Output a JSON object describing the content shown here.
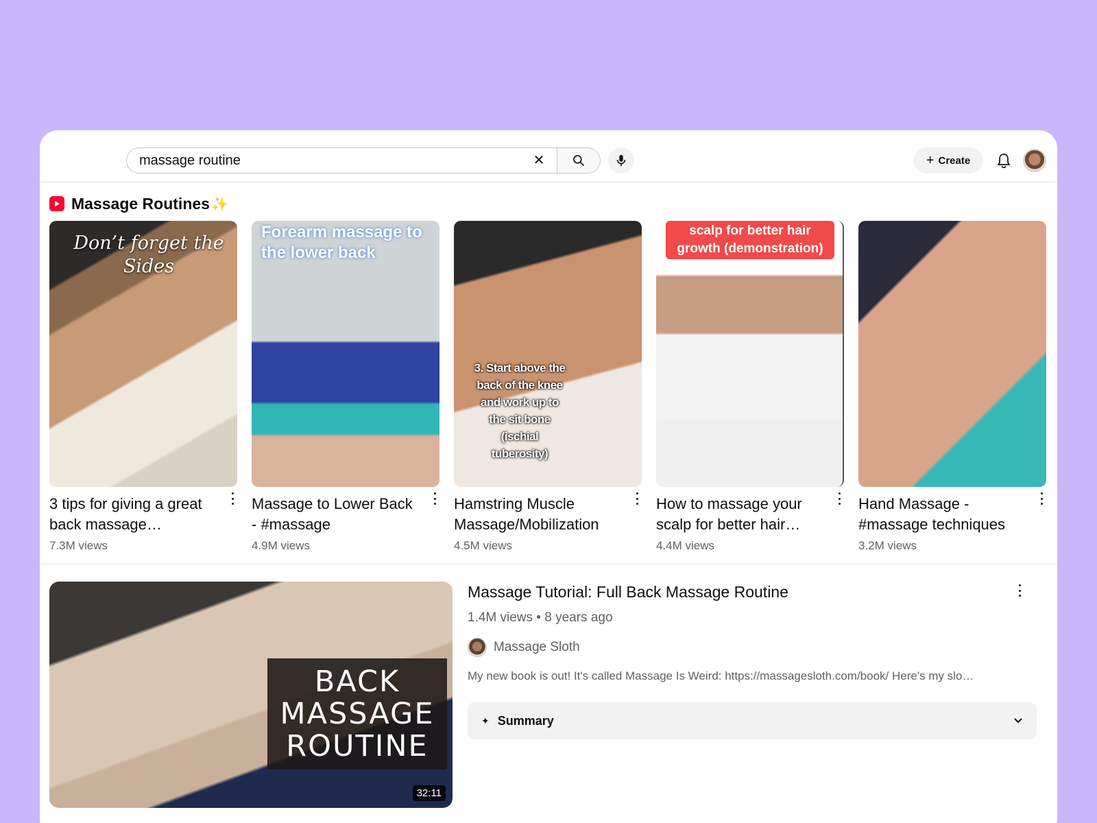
{
  "search": {
    "query": "massage routine",
    "clear_icon": "close-icon",
    "search_icon": "search-icon",
    "mic_icon": "microphone-icon"
  },
  "header": {
    "create_label": "Create",
    "bell_icon": "bell-icon"
  },
  "shorts_shelf": {
    "title": "Massage Routines",
    "sparkle": "✨",
    "items": [
      {
        "title": "3 tips for giving a great back massage…",
        "views": "7.3M views",
        "overlay": "Don’t forget the Sides"
      },
      {
        "title": "Massage to Lower Back - #massage",
        "views": "4.9M views",
        "overlay": "Forearm massage to the lower back"
      },
      {
        "title": "Hamstring Muscle Massage/Mobilization",
        "views": "4.5M views",
        "overlay": "3. Start above the back of the knee and work up to the sit bone (ischial tuberosity)"
      },
      {
        "title": "How to massage your scalp for better hair…",
        "views": "4.4M views",
        "overlay": "scalp for better hair growth (demonstration)"
      },
      {
        "title": "Hand Massage - #massage techniques",
        "views": "3.2M views",
        "overlay": ""
      }
    ]
  },
  "video": {
    "title": "Massage Tutorial: Full Back Massage Routine",
    "meta": "1.4M views • 8 years ago",
    "channel": "Massage Sloth",
    "description": "My new book is out! It's called Massage Is Weird: https://massagesloth.com/book/ Here's my slo…",
    "thumb_text": "BACK MASSAGE ROUTINE",
    "duration": "32:11",
    "summary_label": "Summary"
  },
  "colors": {
    "background": "#c8b8fb",
    "brand_red": "#ff0033"
  }
}
